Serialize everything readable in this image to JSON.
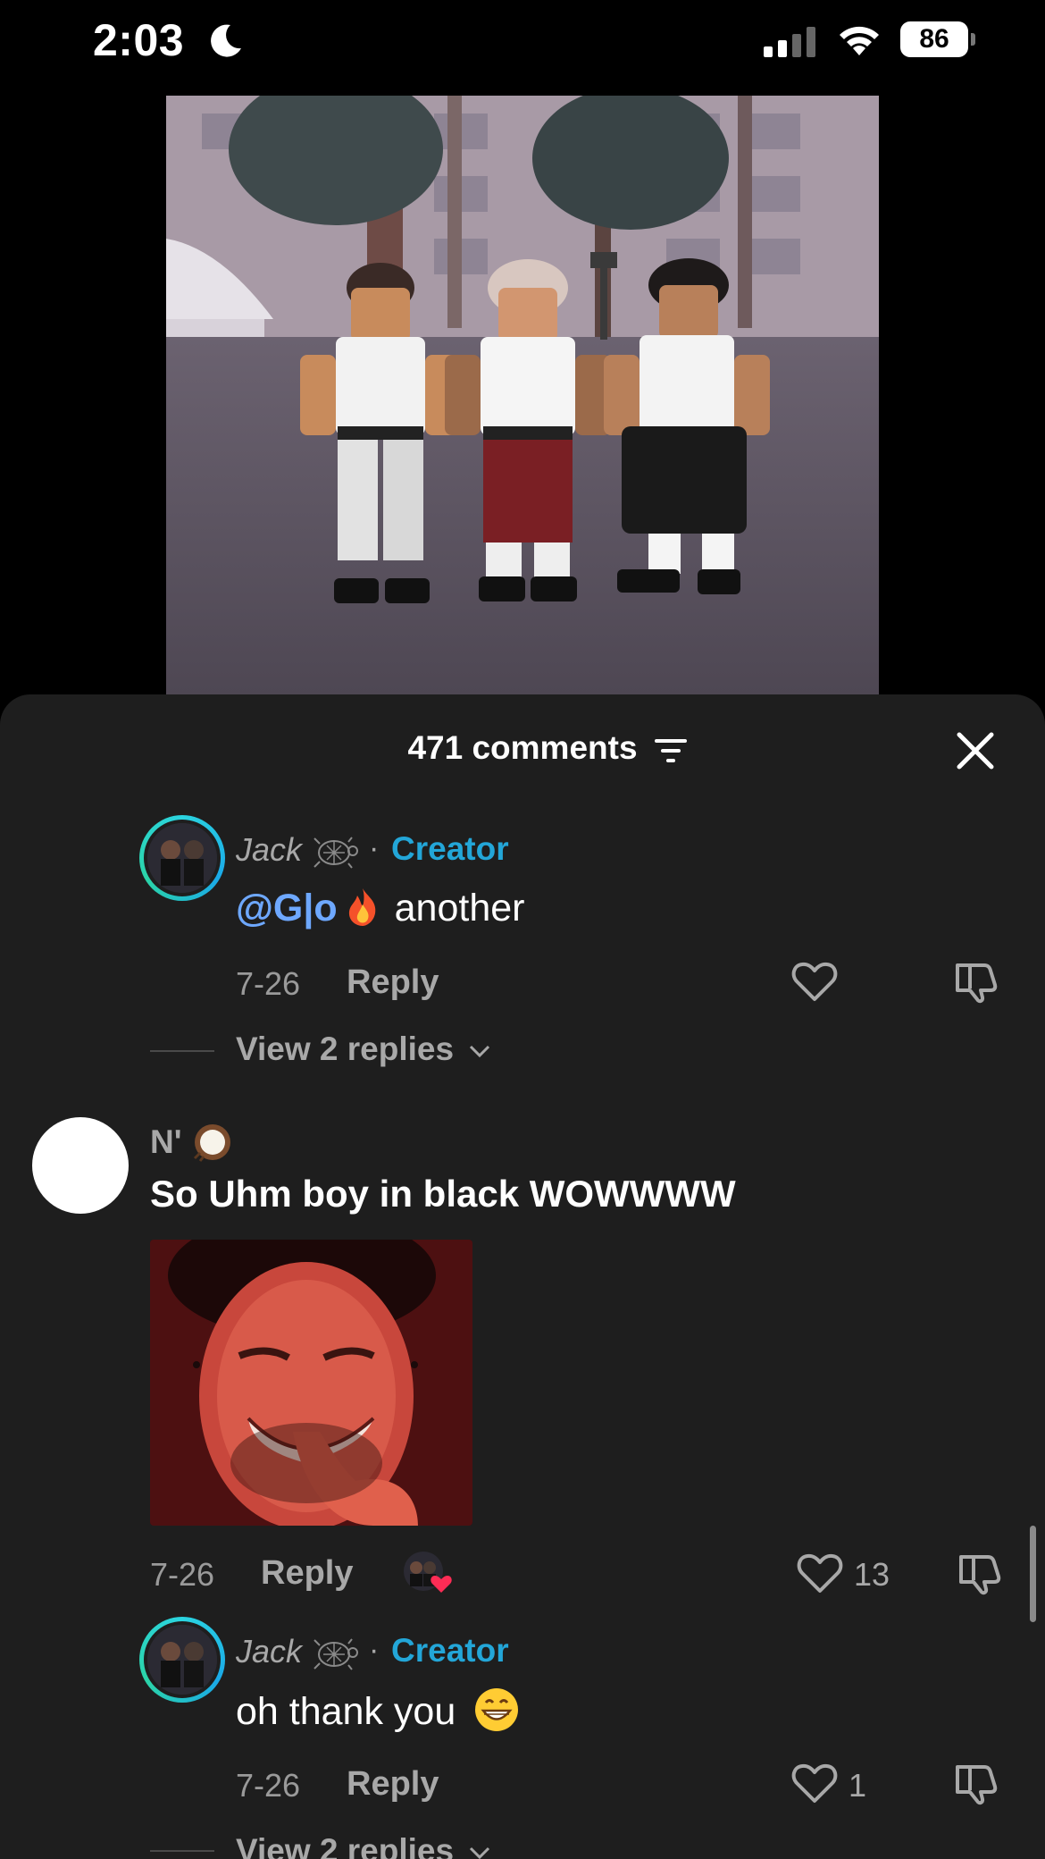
{
  "status_bar": {
    "time": "2:03",
    "battery": "86"
  },
  "sheet": {
    "title": "471 comments"
  },
  "comments": [
    {
      "author": "Jack",
      "creator_label": "Creator",
      "mention": "@G|o",
      "text": " another",
      "date": "7-26",
      "reply_label": "Reply",
      "view_replies": "View 2 replies"
    },
    {
      "author": "N'",
      "text": "So Uhm boy in black WOWWWW",
      "date": "7-26",
      "reply_label": "Reply",
      "likes": "13"
    },
    {
      "author": "Jack",
      "creator_label": "Creator",
      "text": "oh thank you",
      "date": "7-26",
      "reply_label": "Reply",
      "likes": "1",
      "view_replies": "View 2 replies"
    }
  ],
  "colors": {
    "creator": "#23a6d8",
    "mention": "#6ea8ff",
    "sheet_bg": "#1e1e1e"
  },
  "icons": [
    "moon-icon",
    "signal-icon",
    "wifi-icon",
    "filter-icon",
    "close-icon",
    "turtle-icon",
    "fire-emoji",
    "coconut-emoji",
    "grin-emoji",
    "heart-icon",
    "dislike-icon",
    "chevron-down-icon"
  ]
}
